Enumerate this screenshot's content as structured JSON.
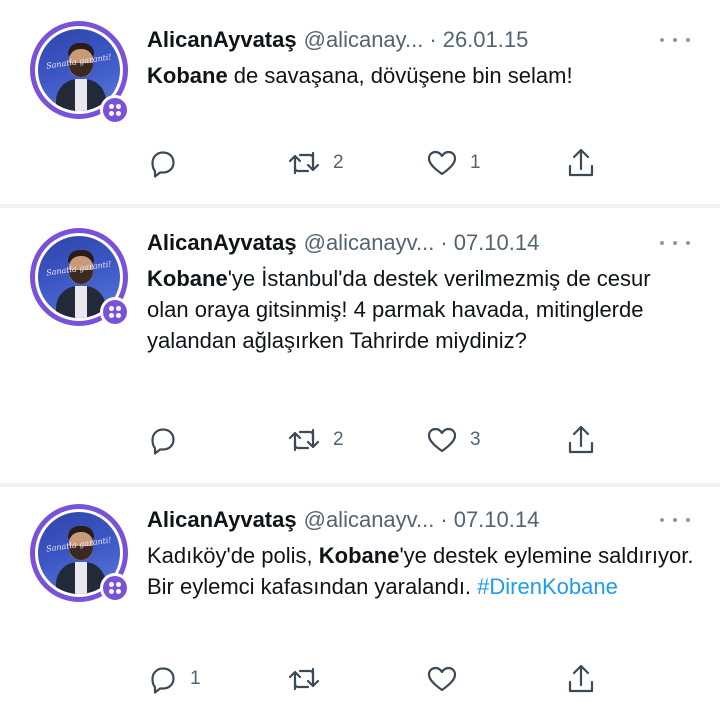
{
  "tweets": [
    {
      "name": "AlicanAyvataş",
      "handle": "@alicanay...",
      "separator": "·",
      "date": "26.01.15",
      "segments": [
        {
          "text": "Kobane",
          "bold": true
        },
        {
          "text": " de savaşana,  dövüşene bin selam!"
        }
      ],
      "replies": "",
      "retweets": "2",
      "likes": "1"
    },
    {
      "name": "AlicanAyvataş",
      "handle": "@alicanayv...",
      "separator": "·",
      "date": "07.10.14",
      "segments": [
        {
          "text": "Kobane",
          "bold": true
        },
        {
          "text": "'ye İstanbul'da destek verilmezmiş de cesur olan oraya gitsinmiş! 4 parmak havada, mitinglerde yalandan ağlaşırken Tahrirde miydiniz?"
        }
      ],
      "replies": "",
      "retweets": "2",
      "likes": "3"
    },
    {
      "name": "AlicanAyvataş",
      "handle": "@alicanayv...",
      "separator": "·",
      "date": "07.10.14",
      "segments": [
        {
          "text": "Kadıköy'de polis, "
        },
        {
          "text": "Kobane",
          "bold": true
        },
        {
          "text": "'ye destek eylemine saldırıyor. Bir eylemci kafasından yaralandı. "
        },
        {
          "text": "#DirenKobane",
          "hashtag": true
        }
      ],
      "replies": "1",
      "retweets": "",
      "likes": ""
    }
  ],
  "avatar_caption": "Sanatla garanti!",
  "icons": {
    "reply": "reply-icon",
    "retweet": "retweet-icon",
    "like": "like-icon",
    "share": "share-icon",
    "more": "more-icon",
    "badge": "team-badge-icon"
  },
  "colors": {
    "text": "#0f1419",
    "secondary": "#536471",
    "hashtag": "#1d9bf0",
    "avatar_ring": "#7a52d9",
    "divider": "#eff3f4"
  }
}
